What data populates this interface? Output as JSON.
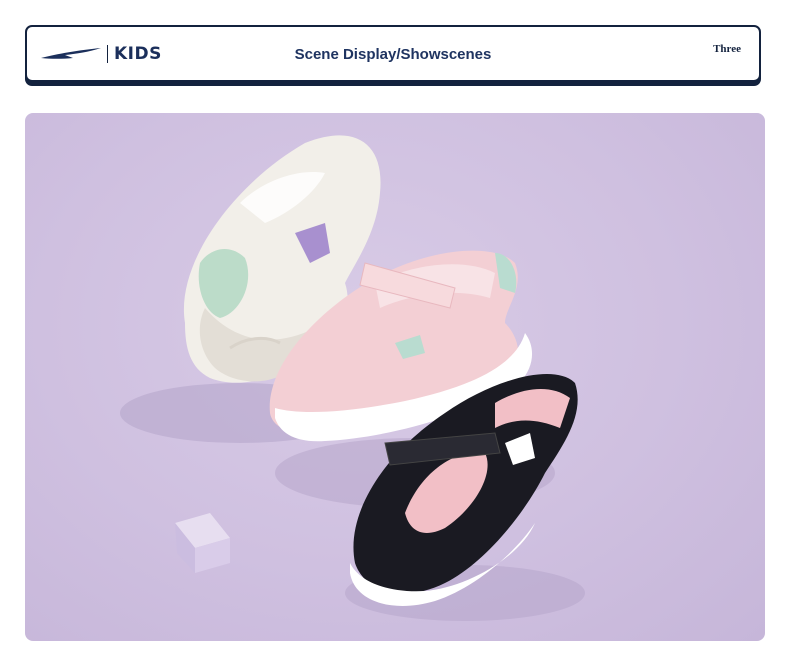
{
  "header": {
    "brand_text": "KIDS",
    "title": "Scene Display/Showscenes",
    "tag": "Three"
  },
  "scene": {
    "image": "product-scene-three-sneakers",
    "background_color": "#d3c5e3"
  },
  "colors": {
    "navy": "#13223e",
    "title_text": "#1f3461",
    "lavender": "#d3c5e3",
    "pink": "#f1cfd3",
    "mint": "#b9dcd0",
    "black": "#1a1a22"
  }
}
